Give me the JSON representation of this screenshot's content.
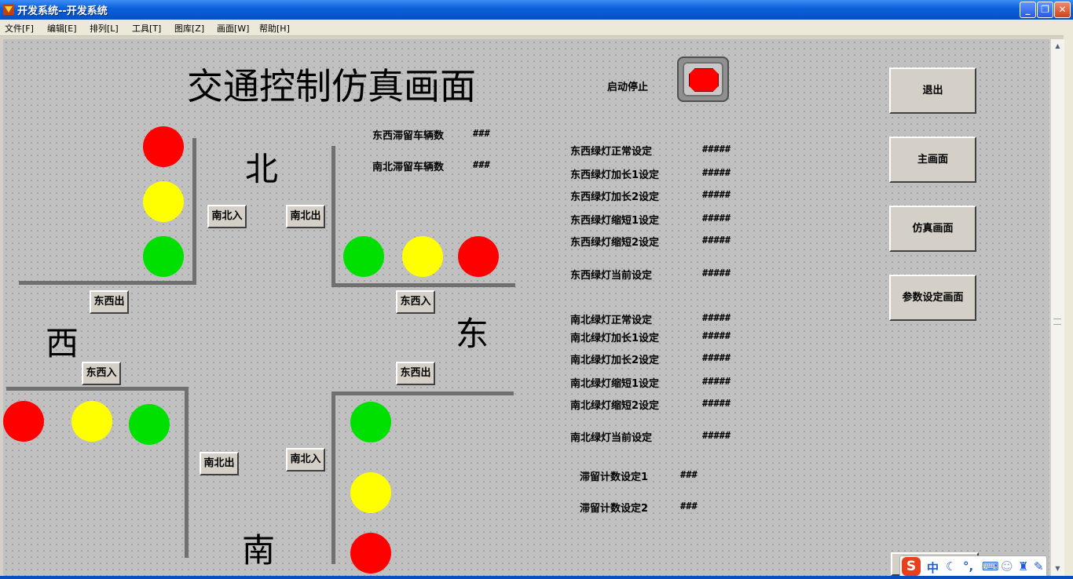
{
  "window": {
    "title": "开发系统--开发系统",
    "controls": {
      "minimize": "_",
      "restore": "❐",
      "close": "✕"
    }
  },
  "menu": {
    "items": [
      "文件[F]",
      "编辑[E]",
      "排列[L]",
      "工具[T]",
      "图库[Z]",
      "画面[W]",
      "帮助[H]"
    ]
  },
  "screen": {
    "title": "交通控制仿真画面",
    "directions": {
      "north": "北",
      "south": "南",
      "east": "东",
      "west": "西"
    },
    "start_stop_label": "启动停止",
    "road_buttons": {
      "ns_in_north": "南北入",
      "ns_out_north": "南北出",
      "ew_out_west": "东西出",
      "ew_in_east": "东西入",
      "ew_in_west": "东西入",
      "ew_out_east": "东西出",
      "ns_out_south": "南北出",
      "ns_in_south": "南北入"
    },
    "queue": {
      "ew_label": "东西滞留车辆数",
      "ew_value": "###",
      "ns_label": "南北滞留车辆数",
      "ns_value": "###"
    },
    "lights": {
      "red": "#ff0000",
      "yellow": "#ffff00",
      "green": "#00e000"
    },
    "settings_ew": [
      {
        "label": "东西绿灯正常设定",
        "value": "#####"
      },
      {
        "label": "东西绿灯加长1设定",
        "value": "#####"
      },
      {
        "label": "东西绿灯加长2设定",
        "value": "#####"
      },
      {
        "label": "东西绿灯缩短1设定",
        "value": "#####"
      },
      {
        "label": "东西绿灯缩短2设定",
        "value": "#####"
      },
      {
        "label": "东西绿灯当前设定",
        "value": "#####"
      }
    ],
    "settings_ns": [
      {
        "label": "南北绿灯正常设定",
        "value": "#####"
      },
      {
        "label": "南北绿灯加长1设定",
        "value": "#####"
      },
      {
        "label": "南北绿灯加长2设定",
        "value": "#####"
      },
      {
        "label": "南北绿灯缩短1设定",
        "value": "#####"
      },
      {
        "label": "南北绿灯缩短2设定",
        "value": "#####"
      },
      {
        "label": "南北绿灯当前设定",
        "value": "#####"
      }
    ],
    "queue_counts": [
      {
        "label": "滞留计数设定1",
        "value": "###"
      },
      {
        "label": "滞留计数设定2",
        "value": "###"
      }
    ],
    "nav_buttons": [
      "退出",
      "主画面",
      "仿真画面",
      "参数设定画面"
    ]
  },
  "ime": {
    "logo": "S",
    "mode": "中",
    "icons": [
      "moon-icon",
      "punct-icon",
      "keyboard-icon",
      "user-icon",
      "shirt-icon",
      "wrench-icon"
    ]
  }
}
